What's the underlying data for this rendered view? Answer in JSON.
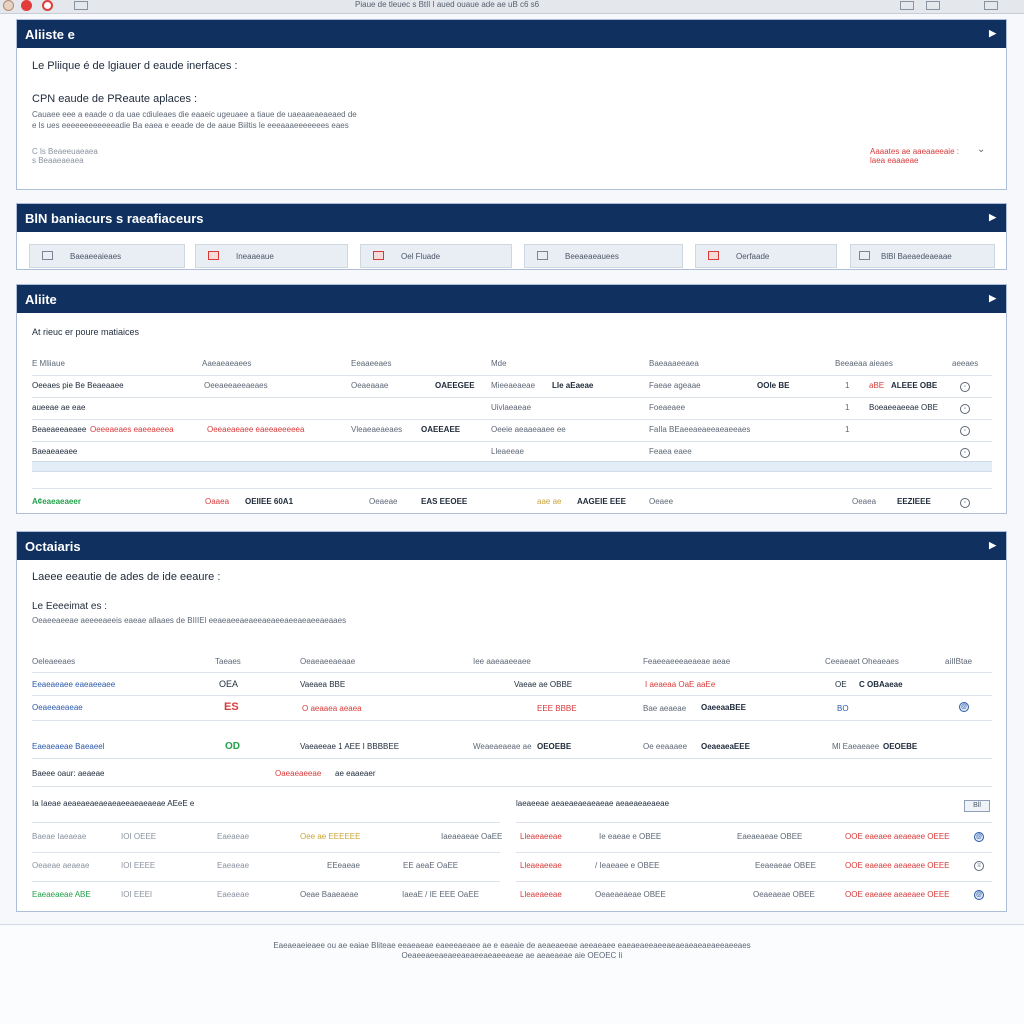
{
  "topbar": {
    "title": "Piaue de tleuec s BtIl I aued ouaue ade ae uB c6 s6"
  },
  "p1": {
    "title": "Aliiste e",
    "heading": "Le Pliique é de lgiauer d eaude inerfaces :",
    "subheading": "CPN eaude de PReaute aplaces :",
    "desc1": "Cauaee eee a eaade o da uae cdiuleaes die eaaeic ugeuaee a tiaue de uaeaaeaeaeaed de",
    "desc2": "e ls ues eeeeeeeeeeeeadie Ba eaea e eeade de de aaue Biiltis le eeeaaaeeeeeees eaes",
    "meta1": "C ls Beaeeuaeaea",
    "meta2": "s Beaaeaeaea",
    "right1": "Aaaates ae aaeaaeeaie :",
    "right2": "laea eaaaeae"
  },
  "p2": {
    "title": "BlN baniacurs s raeafiaceurs",
    "tabs": [
      "Baeaeeaieaes",
      "Ineaaeaue",
      "Oel Fluade",
      "Beeaeaeauees",
      "Oerfaade",
      "BlBl Baeaedeaeaae"
    ]
  },
  "p3": {
    "title": "Aliite",
    "subtitle": "At rieuc er poure matiaices",
    "headers": [
      "E Mliiaue",
      "Aaeaeaeaees",
      "Eeaaeeaes",
      "Mde",
      "Baeaaaeeaea",
      "Beeaeaa aieaes",
      "aeeaes"
    ],
    "rows": [
      [
        "Oeeaes pie Be Beaeaaee",
        "Oeeaeeaeeaeaes",
        "Oeaeaaae",
        "OAEEGEE",
        "Mieeaeaeae",
        "Lle aEaeae",
        "Faeae ageaae",
        "OOle BE",
        "1",
        "aBE",
        "ALEEE OBE"
      ],
      [
        "aueeae ae eae",
        "Uivlaeaeae",
        "Foeaeaee",
        "1",
        "Boeaeeaeeae OBE"
      ],
      [
        "Beaeaeeaeaee",
        "Oeeeaeaes eaeeaeeea",
        "Oeeaeaeaee eaeeaeeeeea",
        "Vleaeaeaeaes",
        "OAEEAEE",
        "Oeeie aeaaeaaee ee",
        "FaIla BEaeeaeaeeaeaeeaes",
        "1"
      ],
      [
        "Baeaeaeaee",
        "Lleaeeae",
        "Feaea eaee"
      ],
      [
        "A¢eaeaeaeer",
        "Oaaea",
        "OEIIEE 60A1",
        "Oeaeae",
        "EAS EEOEE",
        "aae ae",
        "AAGEIE EEE",
        "Oeaee",
        "Oeaea",
        "EEZIEEE"
      ]
    ]
  },
  "p4": {
    "title": "Octaiaris",
    "heading": "Laeee eeautie de ades de ide eeaure :",
    "sub1": "Le Eeeeimat es :",
    "sub2": "Oeaeeaeeae aeeeeaeeis eaeae allaaes de BIIIEl eeaeaeeaeaeeaeaeeaeeaeaeeaeaaes",
    "headers": [
      "Oeleaeeaes",
      "Taeaes",
      "Oeaeaeeaeaae",
      "Iee aaeaaeeaee",
      "Feaeeaeeeaeaeae aeae",
      "Ceeaeaet Oheaeaes",
      "aiIIBtae"
    ],
    "rows": [
      [
        "Eeaeaeaee eaeaeeaee",
        "OEA",
        "Vaeaea BBE",
        "Vaeae ae OBBE",
        "I aeaeaa OaE aaEe",
        "OE",
        "C OBAaeae"
      ],
      [
        "Oeaeeaeaeae",
        "ES",
        "O aeaaea aeaea",
        "EEE BBBE",
        "Bae aeaeae",
        "OaeeaaBEE",
        "BO"
      ],
      [
        "Eaeaeaeae Baeaeel",
        "OD",
        "Vaeaeeae 1 AEE I BBBBEE",
        "Weaeaeaeae ae",
        "OEOEBE",
        "Oe eeaaaee",
        "OeaeaeaEEE",
        "Ml Eaeaeaee",
        "OEOEBE"
      ],
      [
        "Baeee oaur: aeaeae",
        "Oaeaeaeeae",
        "ae eaaeaer"
      ]
    ],
    "leftHeader": "Ia Iaeae aeaeaeaeaeaeaeeaeaeaeae AEeE e",
    "rightHeader": "laeaeeae aeaeaeaeaeaeae aeaeaeaeaeae",
    "leftRows": [
      [
        "Baeae Iaeaeae",
        "IOI OEEE",
        "Eaeaeae",
        "Oee ae EEEEEE",
        "Iaeaeaeae OaEE"
      ],
      [
        "Oeaeae aeaeae",
        "IOI EEEE",
        "Eaeaeae",
        "EEeaeae",
        "EE aeaE OaEE"
      ],
      [
        "Eaeaeaeae ABE",
        "IOI EEEI",
        "Eaeaeae",
        "Oeae Baaeaeae",
        "IaeaE / IE EEE OaEE"
      ]
    ],
    "rightRows": [
      [
        "Lleaeaeeae",
        "Ie eaeae e OBEE",
        "Eaeaeaeae OBEE",
        "OOE eaeaee aeaeaee OEEE"
      ],
      [
        "Lleaeaeeae",
        "/ Ieaeaee e OBEE",
        "Eeaeaeae OBEE",
        "OOE eaeaee aeaeaee OEEE"
      ],
      [
        "Lleaeaeeae",
        "Oeaeaeaeae OBEE",
        "Oeaeaeae OBEE",
        "OOE eaeaee aeaeaee OEEE"
      ]
    ],
    "selLabel": "Bll"
  },
  "footer": {
    "line1": "Eaeaeaeieaee ou ae eaiae Bliteae eeaeaeae eaeeeaeaee ae e eaeaie de aeaeaeeae aeeaeaee eaeaeaeeaeeaeaeaeaeaeaeeaeeaes",
    "line2": "Oeaeeaeeaeaeeaeaeeaeaeeaeae ae aeaeaeae aie OEOEC Ii"
  }
}
